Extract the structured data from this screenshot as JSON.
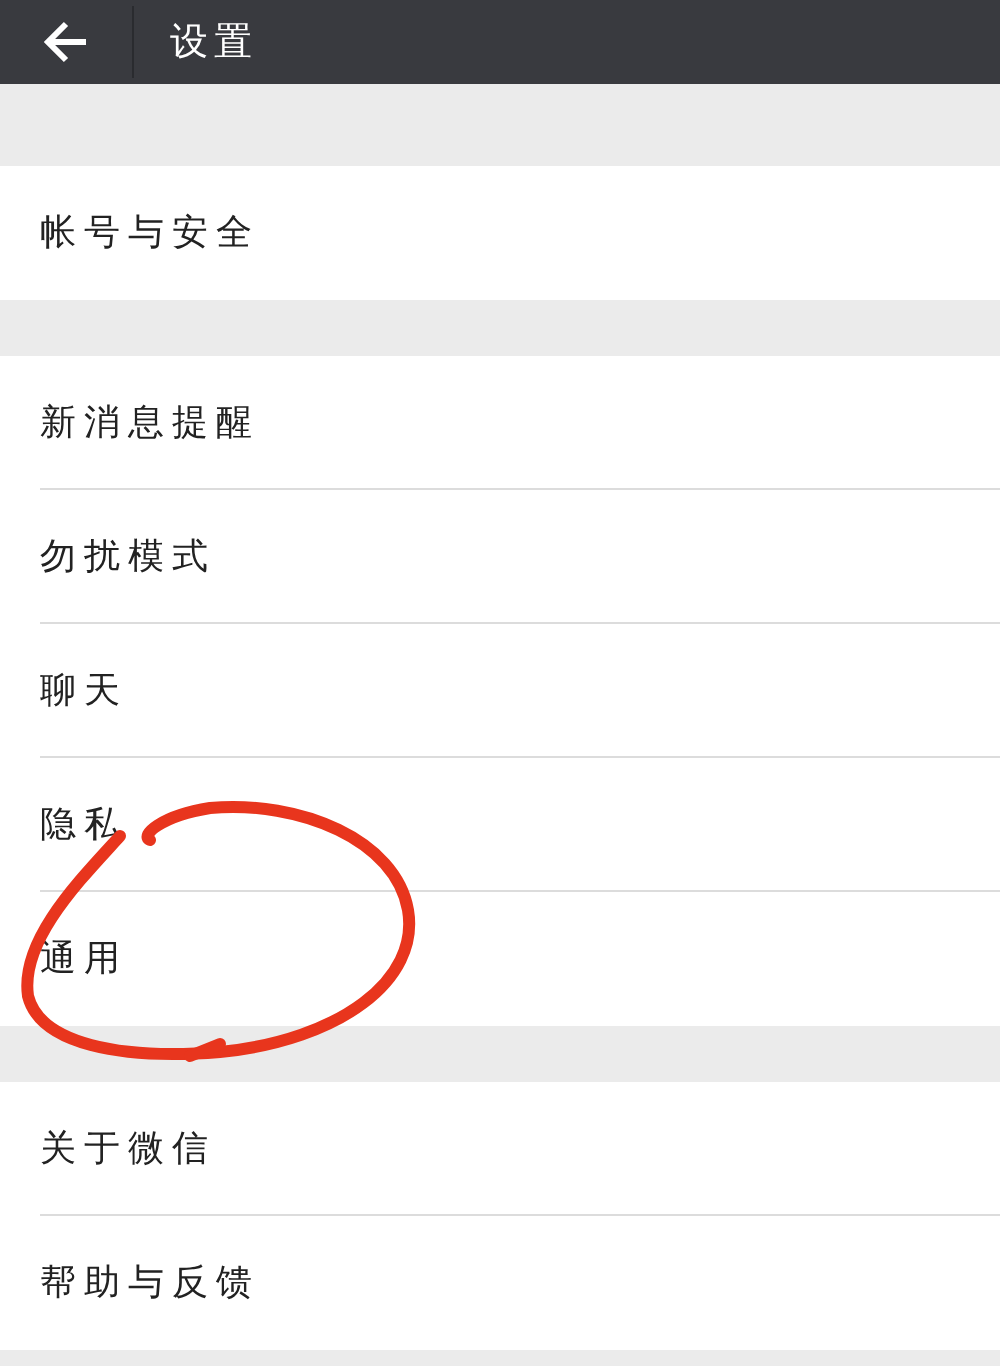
{
  "header": {
    "title": "设置"
  },
  "groups": [
    {
      "items": [
        {
          "label": "帐号与安全"
        }
      ]
    },
    {
      "items": [
        {
          "label": "新消息提醒"
        },
        {
          "label": "勿扰模式"
        },
        {
          "label": "聊天"
        },
        {
          "label": "隐私"
        },
        {
          "label": "通用"
        }
      ]
    },
    {
      "items": [
        {
          "label": "关于微信"
        },
        {
          "label": "帮助与反馈"
        }
      ]
    }
  ]
}
